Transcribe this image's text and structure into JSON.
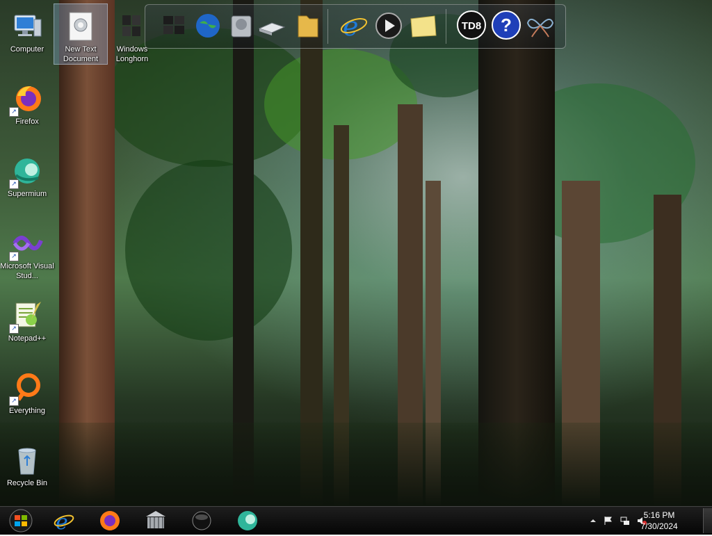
{
  "desktop": {
    "icons": [
      {
        "label": "Computer",
        "icon": "computer-icon"
      },
      {
        "label": "Firefox",
        "icon": "firefox-icon"
      },
      {
        "label": "Supermium",
        "icon": "supermium-icon"
      },
      {
        "label": "Microsoft Visual Stud...",
        "icon": "visual-studio-icon"
      },
      {
        "label": "Notepad++",
        "icon": "notepad-plus-plus-icon"
      },
      {
        "label": "Everything",
        "icon": "everything-search-icon"
      },
      {
        "label": "Recycle Bin",
        "icon": "recycle-bin-icon"
      }
    ],
    "second_column": [
      {
        "label": "New Text Document",
        "icon": "text-document-icon",
        "selected": true
      },
      {
        "label": "Windows Longhorn",
        "icon": "windows-longhorn-icon"
      }
    ]
  },
  "dock": {
    "items": [
      {
        "name": "windows-logo-icon"
      },
      {
        "name": "globe-network-icon"
      },
      {
        "name": "hard-drive-icon"
      },
      {
        "name": "scanner-drive-icon"
      },
      {
        "name": "folder-icon"
      },
      {
        "name": "internet-explorer-icon"
      },
      {
        "name": "media-player-icon"
      },
      {
        "name": "sticky-note-icon"
      },
      {
        "name": "td8-label",
        "text": "TD8"
      },
      {
        "name": "help-icon",
        "text": "?"
      },
      {
        "name": "butterfly-icon"
      }
    ]
  },
  "taskbar": {
    "pinned": [
      {
        "name": "internet-explorer-icon"
      },
      {
        "name": "firefox-icon"
      },
      {
        "name": "library-building-icon"
      },
      {
        "name": "black-orb-icon"
      },
      {
        "name": "supermium-icon"
      }
    ],
    "clock": {
      "time": "5:16 PM",
      "date": "7/30/2024"
    }
  },
  "colors": {
    "taskbar": "#0a0a0a",
    "ie_blue": "#1e7ad8",
    "firefox_orange": "#ff7a18",
    "supermium_teal": "#2fb59a"
  }
}
